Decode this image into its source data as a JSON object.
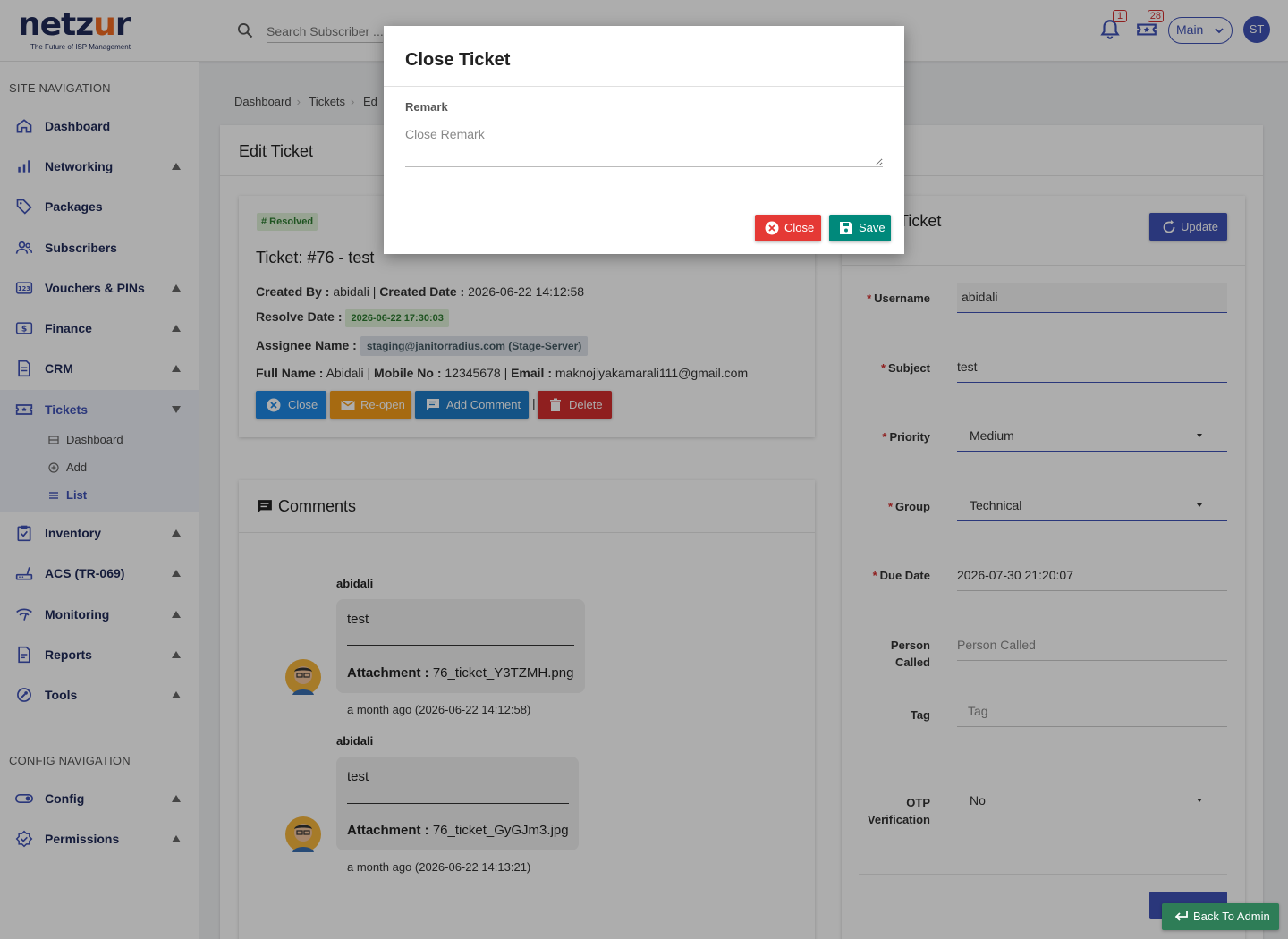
{
  "brand": {
    "name_part1": "netz",
    "name_part2": "u",
    "name_part3": "r",
    "tagline": "The Future of ISP Management"
  },
  "header": {
    "search_placeholder": "Search Subscriber ...",
    "notifications_count": "1",
    "tickets_count": "28",
    "site_selector": "Main",
    "user_initials": "ST"
  },
  "sidebar": {
    "site_nav_title": "SITE NAVIGATION",
    "config_nav_title": "CONFIG NAVIGATION",
    "items": [
      {
        "label": "Dashboard",
        "icon": "home-icon"
      },
      {
        "label": "Networking",
        "icon": "bar-chart-icon"
      },
      {
        "label": "Packages",
        "icon": "tag-icon"
      },
      {
        "label": "Subscribers",
        "icon": "users-icon"
      },
      {
        "label": "Vouchers & PINs",
        "icon": "pin-123-icon"
      },
      {
        "label": "Finance",
        "icon": "dollar-icon"
      },
      {
        "label": "CRM",
        "icon": "document-icon"
      },
      {
        "label": "Tickets",
        "icon": "ticket-icon"
      },
      {
        "label": "Inventory",
        "icon": "clipboard-icon"
      },
      {
        "label": "ACS (TR-069)",
        "icon": "router-icon"
      },
      {
        "label": "Monitoring",
        "icon": "wifi-icon"
      },
      {
        "label": "Reports",
        "icon": "report-icon"
      },
      {
        "label": "Tools",
        "icon": "tools-icon"
      }
    ],
    "ticket_sub": [
      {
        "label": "Dashboard"
      },
      {
        "label": "Add"
      },
      {
        "label": "List"
      }
    ],
    "config_items": [
      {
        "label": "Config",
        "icon": "toggle-icon"
      },
      {
        "label": "Permissions",
        "icon": "shield-check-icon"
      }
    ]
  },
  "breadcrumb": [
    "Dashboard",
    "Tickets",
    "Ed"
  ],
  "page_title": "Edit Ticket",
  "ticket": {
    "status": "# Resolved",
    "title": "Ticket: #76 - test",
    "created_by_label": "Created By :",
    "created_by": "abidali",
    "created_date_label": "Created Date :",
    "created_date": "2026-06-22 14:12:58",
    "resolve_date_label": "Resolve Date :",
    "resolve_date": "2026-06-22 17:30:03",
    "assignee_label": "Assignee Name :",
    "assignee": "staging@janitorradius.com (Stage-Server)",
    "full_name_label": "Full Name :",
    "full_name": "Abidali",
    "mobile_label": "Mobile No :",
    "mobile": "12345678",
    "email_label": "Email :",
    "email": "maknojiyakamarali111@gmail.com",
    "separator": "|",
    "actions": {
      "close": "Close",
      "reopen": "Re-open",
      "add_comment": "Add Comment",
      "delete": "Delete"
    }
  },
  "comments": {
    "title": "Comments",
    "items": [
      {
        "user": "abidali",
        "text": "test",
        "attachment_label": "Attachment :",
        "attachment": "76_ticket_Y3TZMH.png",
        "time": "a month ago (2026-06-22 14:12:58)"
      },
      {
        "user": "abidali",
        "text": "test",
        "attachment_label": "Attachment :",
        "attachment": "76_ticket_GyGJm3.jpg",
        "time": "a month ago (2026-06-22 14:13:21)"
      }
    ]
  },
  "form": {
    "title_fragment": "Ticket",
    "update_label": "Update",
    "fields": {
      "username": {
        "label": "Username",
        "value": "abidali"
      },
      "subject": {
        "label": "Subject",
        "value": "test"
      },
      "priority": {
        "label": "Priority",
        "value": "Medium"
      },
      "group": {
        "label": "Group",
        "value": "Technical"
      },
      "due_date": {
        "label": "Due Date",
        "value": "2026-07-30 21:20:07"
      },
      "person_called": {
        "label_line1": "Person",
        "label_line2": "Called",
        "placeholder": "Person Called"
      },
      "tag": {
        "label": "Tag",
        "placeholder": "Tag"
      },
      "otp": {
        "label_line1": "OTP",
        "label_line2": "Verification",
        "value": "No"
      }
    }
  },
  "back_to_admin": "Back To Admin",
  "modal": {
    "title": "Close Ticket",
    "remark_label": "Remark",
    "remark_placeholder": "Close Remark",
    "close_label": "Close",
    "save_label": "Save"
  },
  "colors": {
    "primary": "#3f51b5",
    "navy": "#1f2a57",
    "orange": "#f26a21",
    "red": "#e53935",
    "teal": "#00897b",
    "blue": "#1e88e5",
    "amber": "#f59c1a"
  }
}
